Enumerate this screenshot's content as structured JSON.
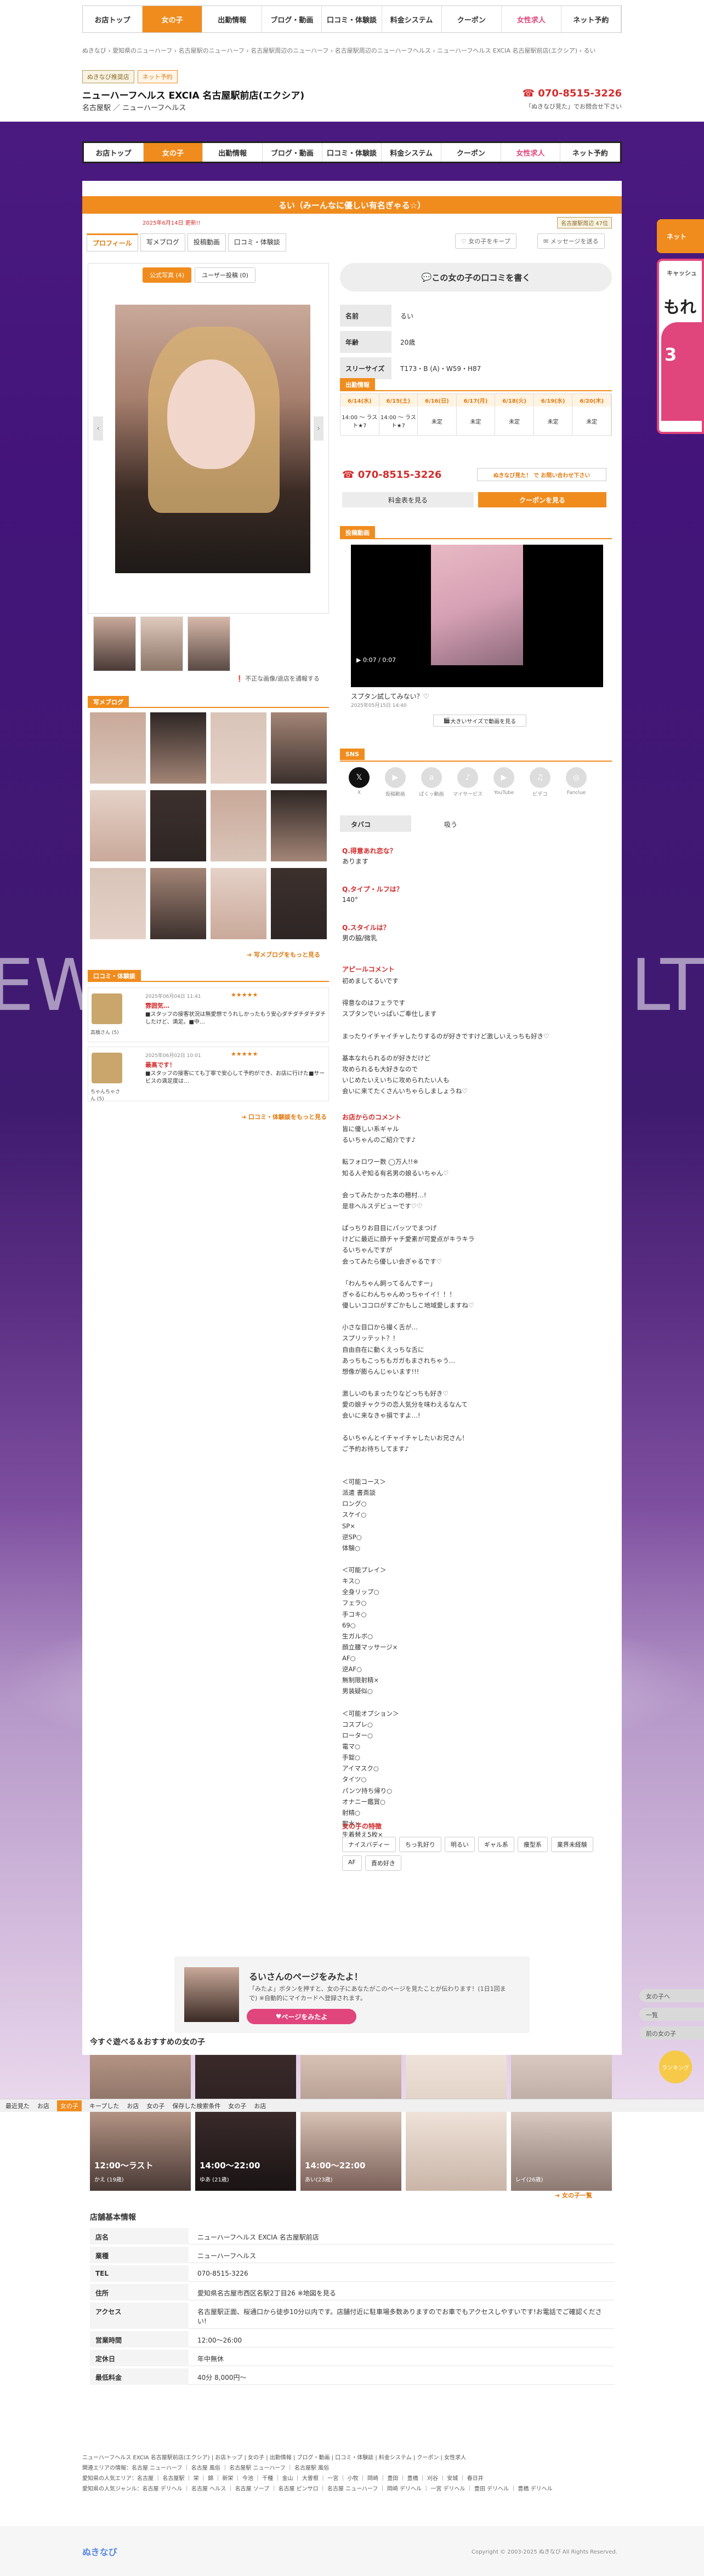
{
  "nav": [
    "お店トップ",
    "女の子",
    "出勤情報",
    "ブログ・動画",
    "口コミ・体験談",
    "料金システム",
    "クーポン",
    "女性求人",
    "ネット予約"
  ],
  "breadcrumb": "ぬきなび  ›  愛知県のニューハーフ  ›  名古屋駅のニューハーフ  ›  名古屋駅周辺のニューハーフ  ›  名古屋駅周辺のニューハーフヘルス  ›  ニューハーフヘルス EXCIA 名古屋駅前店(エクシア)  ›  るい",
  "shop": {
    "tags": [
      "ぬきなび推奨店",
      "ネット予約"
    ],
    "name": "ニューハーフヘルス EXCIA 名古屋駅前店(エクシア)",
    "sub": "名古屋駅 ／ ニューハーフヘルス",
    "tel": "070-8515-3226",
    "tel_note": "「ぬきなび見た」でお問合せ下さい"
  },
  "girl": {
    "title": "るい（みーんなに優しい有名ぎゃる☆）",
    "updated": "2025年6月14日 更新!!",
    "rank": "名古屋駅周辺 47位",
    "tabs": [
      "プロフィール",
      "写メブログ",
      "投稿動画",
      "口コミ・体験談"
    ],
    "actions": [
      "女の子をキープ",
      "メッセージを送る"
    ],
    "photo_tabs": [
      "公式写真 (4)",
      "ユーザー投稿 (0)"
    ],
    "report": "不正な画像/退店を通報する",
    "kuchikomi_btn": "この女の子の口コミを書く",
    "profile": [
      {
        "k": "名前",
        "v": "るい"
      },
      {
        "k": "年齢",
        "v": "20歳"
      },
      {
        "k": "スリーサイズ",
        "v": "T173・B (A)・W59・H87"
      }
    ]
  },
  "blog": {
    "head": "写メブログ",
    "more": "写メブログをもっと見る"
  },
  "reviews": {
    "head": "口コミ・体験談",
    "more": "口コミ・体験談をもっと見る",
    "items": [
      {
        "name": "高橋さん (5)",
        "date": "2025年06月04日 11:41",
        "stars": "★★★★★",
        "title": "雰囲気…",
        "body": "■スタッフの接客状況は無愛想でうれしかったもう安心ダチダチダチダチしたけど、満足。■中…"
      },
      {
        "name": "ちゃんちゃさん (5)",
        "date": "2025年06月02日 10:01",
        "stars": "★★★★★",
        "title": "最高です！",
        "body": "■スタッフの接客にても丁寧で安心して予約ができ、お店に行けた■サービスの満足度は…"
      }
    ]
  },
  "schedule": {
    "head": "出勤情報",
    "days": [
      "6/14(水)",
      "6/15(土)",
      "6/16(日)",
      "6/17(月)",
      "6/18(火)",
      "6/19(水)",
      "6/20(木)"
    ],
    "cells": [
      "14:00 〜 ラスト★7",
      "14:00 〜 ラスト★7",
      "未定",
      "未定",
      "未定",
      "未定",
      "未定"
    ]
  },
  "contact": {
    "tel": "070-8515-3226",
    "tel_btn": "ぬきなび見た！ で お問い合わせ下さい",
    "price_btn": "料金表を見る",
    "coupon_btn": "クーポンを見る"
  },
  "video": {
    "head": "投稿動画",
    "time": "0:07 / 0:07",
    "caption": "スプタン試してみない？♡",
    "date": "2025年05月15日 14:40",
    "btn": "大きいサイズで動画を見る"
  },
  "sns": {
    "head": "SNS",
    "items": [
      "X",
      "投稿動画",
      "ぱくッ動画",
      "マイサービス",
      "YouTube",
      "ビデコ",
      "Fanclue"
    ]
  },
  "smoking": {
    "k": "タバコ",
    "v": "吸う"
  },
  "qa": [
    {
      "q": "Q.得意あれ恋な？",
      "a": "あります"
    },
    {
      "q": "Q.タイプ・ルフは？",
      "a": "140°"
    },
    {
      "q": "Q.スタイルは？",
      "a": "男の脇/微乳"
    }
  ],
  "appeal": {
    "head": "アピールコメント",
    "text": "初めましてるいです\n\n得意なのはフェラです\nスプタンでいっぱいご奉仕します\n\nまったりイチャイチャしたりするのが好きですけど激しいえっちも好き♡\n\n基本なれられるのが好きだけど\n攻められるも大好きなので\nいじめたいえいちに攻められたい人も\n会いに来てたくさんいちゃらしましょうね♡"
  },
  "shopcomment": {
    "head": "お店からのコメント",
    "text": "皆に優しい系ギャル\nるいちゃんのご紹介です♪\n\n転フォロワー数 ◯万人!!※\n知る人ぞ知る有名男の娘るいちゃん♡\n\n会ってみたかった本の穂村…!\n是非ヘルスデビューです♡♡\n\nぱっちりお目目にパッツでまつげ\nけどに最近に顔チャチ愛素が可愛点がキラキラ\nるいちゃんですが\n会ってみたら優しい会ぎゃるです♡\n\n「わんちゃん飼ってるんですー」\nぎゃるにわんちゃんめっちゃイイ！！！\n優しいココロがすごかもしこ地域愛しますね♡\n\n小さな目口から撮く舌が…\nスプリッテット？！\n自由自在に動くえっちな舌に\nあっちもこっちもガガもまされちゃう…\n想像が膨らんじゃいます!!!\n\n激しいのもまったりなどっちも好き♡\n愛の娘チャクラの恋人気分を味わえるなんて\n会いに来なきゃ損ですよ…!\n\nるいちゃんとイチャイチャしたいお兄さん！\nご予約お待ちしてます♪\n\n\n＜可能コース＞\n派遣 書斎談\nロング○\nスケイ○\nSP×\n逆SP○\n体験○\n\n＜可能プレイ＞\nキス○\n全身リップ○\nフェラ○\n手コキ○\n69○\n生ガルボ○\n顔立腰マッサージ×\nAF○\n逆AF○\n無制限射精×\n男装疑似○\n\n＜可能オプション＞\nコスプレ○\nローター○\n電マ○\n手錠○\nアイマスク○\nタイツ○\nパンツ持ち帰り○\nオナニー鑑賞○\n射精○\n聖水×\n生着替え5枚×\n動画撮影×"
  },
  "features": {
    "head": "女の子の特徴",
    "items": [
      "ナイスバディー",
      "ちっ乳好り",
      "明るい",
      "ギャル系",
      "痩型系",
      "業界未経験",
      "AF",
      "責め好き"
    ]
  },
  "banner": {
    "title": "るいさんのページをみたよ！",
    "text": "「みたよ」ボタンを押すと、女の子にあなたがこのページを見たことが伝わります！(1日1回まで) ※自動的にマイカードへ登録されます。",
    "btn": "ページをみたよ"
  },
  "recommend": {
    "head": "今すぐ遊べる＆おすすめの女の子",
    "more": "女の子一覧",
    "items": [
      {
        "time": "12:00〜ラスト",
        "name": "かえ (19歳)"
      },
      {
        "time": "14:00〜22:00",
        "name": "ゆあ (21歳)"
      },
      {
        "time": "14:00〜22:00",
        "name": "あい(23歳)"
      },
      {
        "time": "",
        "name": ""
      },
      {
        "time": "",
        "name": "レイ(26歳)"
      }
    ]
  },
  "toolbar": [
    "最近見た",
    "お店",
    "女の子",
    "キープした",
    "お店",
    "女の子",
    "保存した検索条件",
    "女の子",
    "お店"
  ],
  "shopinfo": {
    "head": "店舗基本情報",
    "rows": [
      {
        "k": "店名",
        "v": "ニューハーフヘルス EXCIA 名古屋駅前店"
      },
      {
        "k": "業種",
        "v": "ニューハーフヘルス"
      },
      {
        "k": "TEL",
        "v": "070-8515-3226"
      },
      {
        "k": "住所",
        "v": "愛知県名古屋市西区名駅2丁目26 ※地図を見る"
      },
      {
        "k": "アクセス",
        "v": "名古屋駅正面、桜通口から徒歩10分以内です。店舗付近に駐車場多数ありますのでお車でもアクセスしやすいです!お電話でご確認ください!"
      },
      {
        "k": "営業時間",
        "v": "12:00〜26:00"
      },
      {
        "k": "定休日",
        "v": "年中無休"
      },
      {
        "k": "最低料金",
        "v": "40分 8,000円〜"
      }
    ]
  },
  "footer": {
    "line1": "ニューハーフヘルス EXCIA 名古屋駅前店(エクシア)  |  お店トップ  |  女の子  |  出勤情報  |  ブログ・動画  |  口コミ・体験談  |  料金システム  |  クーポン  |  女性求人",
    "line2": "関連エリアの情報：名古屋 ニューハーフ ｜ 名古屋 風俗 ｜ 名古屋駅 ニューハーフ ｜ 名古屋駅 風俗",
    "line3": "愛知県の人気エリア：名古屋 ｜ 名古屋駅 ｜ 栄 ｜ 錦 ｜ 新栄 ｜ 今池 ｜ 千種 ｜ 金山 ｜ 大曽根 ｜ 一宮 ｜ 小牧 ｜ 岡崎 ｜ 豊田 ｜ 豊橋 ｜ 刈谷 ｜ 安城 ｜ 春日井",
    "line4": "愛知県の人気ジャンル：名古屋 デリヘル ｜ 名古屋 ヘルス ｜ 名古屋 ソープ ｜ 名古屋 ピンサロ ｜ 名古屋 ニューハーフ ｜ 岡崎 デリヘル ｜ 一宮 デリヘル ｜ 豊田 デリヘル ｜ 豊橋 デリヘル",
    "logo": "ぬきなび",
    "copyright": "Copyright © 2003-2025 ぬきなび All Rights Reserved."
  },
  "side": {
    "tab": "ネット",
    "ad_top": "キャッシュ",
    "ad_mid": "もれ",
    "ad_big": "3",
    "float": [
      "女の子へ",
      "一覧",
      "前の女の子"
    ],
    "dot": "ランキング"
  },
  "bg_text": [
    "EW",
    "LT"
  ]
}
